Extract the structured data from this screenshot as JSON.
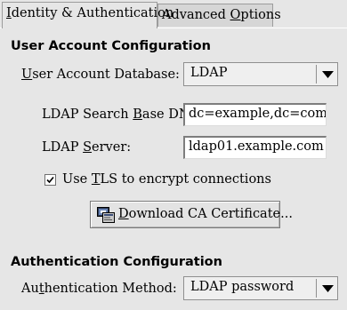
{
  "tabs": [
    {
      "pre": "",
      "key": "I",
      "post": "dentity & Authentication"
    },
    {
      "pre": "Advanced ",
      "key": "O",
      "post": "ptions"
    }
  ],
  "user_account": {
    "title": "User Account Configuration",
    "database_label": {
      "pre": "",
      "key": "U",
      "post": "ser Account Database:"
    },
    "database_value": "LDAP",
    "base_dn_label": {
      "pre": "LDAP Search ",
      "key": "B",
      "post": "ase DN:"
    },
    "base_dn_value": "dc=example,dc=com",
    "server_label": {
      "pre": "LDAP ",
      "key": "S",
      "post": "erver:"
    },
    "server_value": "ldap01.example.com",
    "tls": {
      "pre": "Use ",
      "key": "T",
      "post": "LS to encrypt connections",
      "checked": true
    },
    "download_button": {
      "pre": "",
      "key": "D",
      "post": "ownload CA Certificate..."
    }
  },
  "auth": {
    "title": "Authentication Configuration",
    "method_label": {
      "pre": "Au",
      "key": "t",
      "post": "hentication Method:"
    },
    "method_value": "LDAP password"
  },
  "icons": {
    "dropdown": "triangle-down-icon",
    "check": "checkmark-icon",
    "certificate": "certificate-icon"
  }
}
